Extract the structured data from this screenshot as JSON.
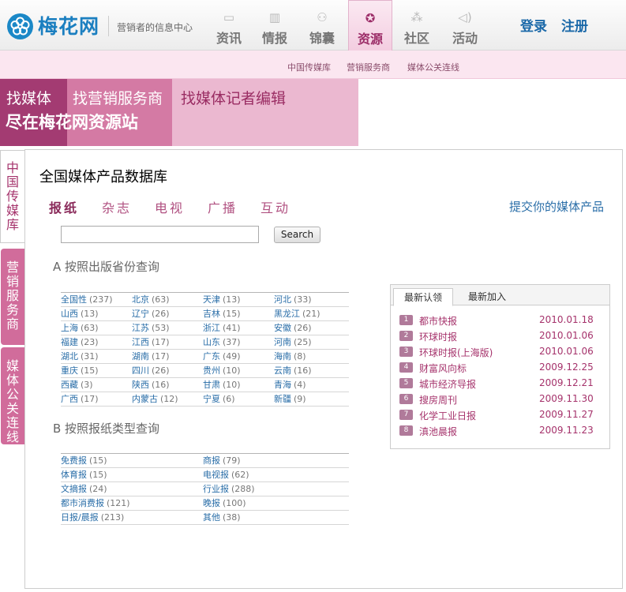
{
  "header": {
    "logo": "梅花网",
    "slogan": "营销者的信息中心",
    "nav": [
      {
        "label": "资讯",
        "icon": "megaphone-icon"
      },
      {
        "label": "情报",
        "icon": "chart-icon"
      },
      {
        "label": "锦囊",
        "icon": "people-icon"
      },
      {
        "label": "资源",
        "icon": "network-icon"
      },
      {
        "label": "社区",
        "icon": "community-icon"
      },
      {
        "label": "活动",
        "icon": "speaker-icon"
      }
    ],
    "login": "登录",
    "register": "注册"
  },
  "subnav": [
    "中国传媒库",
    "营销服务商",
    "媒体公关连线"
  ],
  "banner": {
    "t1": "找媒体",
    "t2": "找营销服务商",
    "t3": "找媒体记者编辑",
    "sub": "尽在梅花网资源站"
  },
  "side_tabs": [
    "中国传媒库",
    "营销服务商",
    "媒体公关连线"
  ],
  "main": {
    "title": "全国媒体产品数据库",
    "media_tabs": [
      "报纸",
      "杂志",
      "电视",
      "广播",
      "互动"
    ],
    "submit_link": "提交你的媒体产品",
    "search_button": "Search",
    "section_a": "A 按照出版省份查询",
    "section_b": "B 按照报纸类型查询"
  },
  "provinces": [
    [
      [
        "全国性",
        "(237)"
      ],
      [
        "北京",
        "(63)"
      ],
      [
        "天津",
        "(13)"
      ],
      [
        "河北",
        "(33)"
      ]
    ],
    [
      [
        "山西",
        "(13)"
      ],
      [
        "辽宁",
        "(26)"
      ],
      [
        "吉林",
        "(15)"
      ],
      [
        "黑龙江",
        "(21)"
      ]
    ],
    [
      [
        "上海",
        "(63)"
      ],
      [
        "江苏",
        "(53)"
      ],
      [
        "浙江",
        "(41)"
      ],
      [
        "安徽",
        "(26)"
      ]
    ],
    [
      [
        "福建",
        "(23)"
      ],
      [
        "江西",
        "(17)"
      ],
      [
        "山东",
        "(37)"
      ],
      [
        "河南",
        "(25)"
      ]
    ],
    [
      [
        "湖北",
        "(31)"
      ],
      [
        "湖南",
        "(17)"
      ],
      [
        "广东",
        "(49)"
      ],
      [
        "海南",
        "(8)"
      ]
    ],
    [
      [
        "重庆",
        "(15)"
      ],
      [
        "四川",
        "(26)"
      ],
      [
        "贵州",
        "(10)"
      ],
      [
        "云南",
        "(16)"
      ]
    ],
    [
      [
        "西藏",
        "(3)"
      ],
      [
        "陕西",
        "(16)"
      ],
      [
        "甘肃",
        "(10)"
      ],
      [
        "青海",
        "(4)"
      ]
    ],
    [
      [
        "广西",
        "(17)"
      ],
      [
        "内蒙古",
        "(12)"
      ],
      [
        "宁夏",
        "(6)"
      ],
      [
        "新疆",
        "(9)"
      ]
    ]
  ],
  "types": [
    [
      [
        "免费报",
        "(15)"
      ],
      [
        "商报",
        "(79)"
      ]
    ],
    [
      [
        "体育报",
        "(15)"
      ],
      [
        "电视报",
        "(62)"
      ]
    ],
    [
      [
        "文摘报",
        "(24)"
      ],
      [
        "行业报",
        "(288)"
      ]
    ],
    [
      [
        "都市消费报",
        "(121)"
      ],
      [
        "晚报",
        "(100)"
      ]
    ],
    [
      [
        "日报/晨报",
        "(213)"
      ],
      [
        "其他",
        "(38)"
      ]
    ]
  ],
  "latest": {
    "tabs": [
      "最新认领",
      "最新加入"
    ],
    "items": [
      {
        "n": "1",
        "title": "都市快报",
        "date": "2010.01.18"
      },
      {
        "n": "2",
        "title": "环球时报",
        "date": "2010.01.06"
      },
      {
        "n": "3",
        "title": "环球时报(上海版)",
        "date": "2010.01.06"
      },
      {
        "n": "4",
        "title": "财富风向标",
        "date": "2009.12.25"
      },
      {
        "n": "5",
        "title": "城市经济导报",
        "date": "2009.12.21"
      },
      {
        "n": "6",
        "title": "搜房周刊",
        "date": "2009.11.30"
      },
      {
        "n": "7",
        "title": "化学工业日报",
        "date": "2009.11.27"
      },
      {
        "n": "8",
        "title": "滇池晨报",
        "date": "2009.11.23"
      }
    ]
  }
}
